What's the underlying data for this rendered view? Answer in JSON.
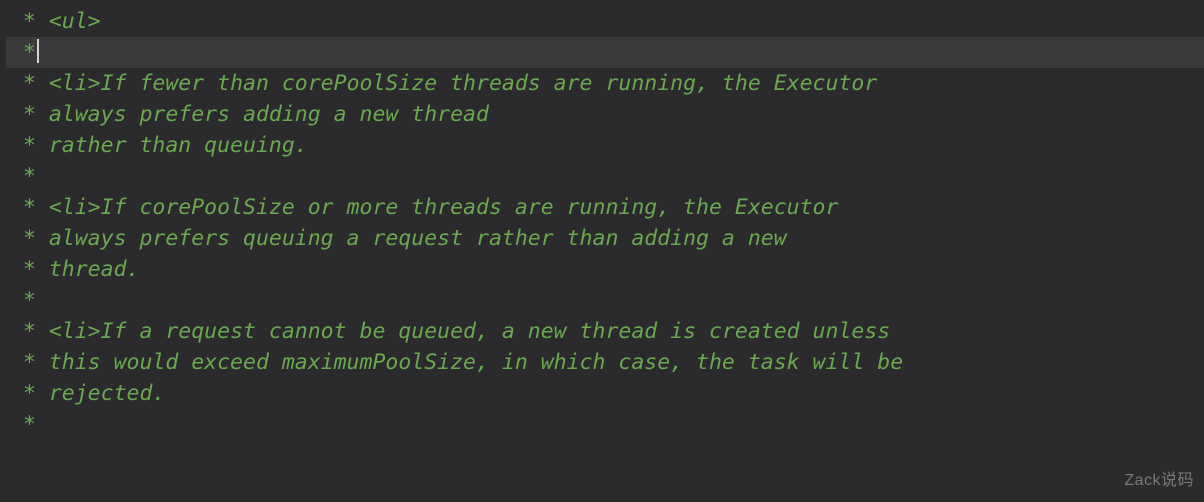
{
  "watermark": "Zack说码",
  "lines": [
    {
      "prefix": " * ",
      "tag": "<ul>",
      "text": "",
      "current": false
    },
    {
      "prefix": " *",
      "tag": "",
      "text": "",
      "current": true
    },
    {
      "prefix": " * ",
      "tag": "<li>",
      "text": "If fewer than corePoolSize threads are running, the Executor",
      "current": false
    },
    {
      "prefix": " * ",
      "tag": "",
      "text": "always prefers adding a new thread",
      "current": false
    },
    {
      "prefix": " * ",
      "tag": "",
      "text": "rather than queuing.",
      "current": false
    },
    {
      "prefix": " *",
      "tag": "",
      "text": "",
      "current": false
    },
    {
      "prefix": " * ",
      "tag": "<li>",
      "text": "If corePoolSize or more threads are running, the Executor",
      "current": false
    },
    {
      "prefix": " * ",
      "tag": "",
      "text": "always prefers queuing a request rather than adding a new",
      "current": false
    },
    {
      "prefix": " * ",
      "tag": "",
      "text": "thread.",
      "current": false
    },
    {
      "prefix": " *",
      "tag": "",
      "text": "",
      "current": false
    },
    {
      "prefix": " * ",
      "tag": "<li>",
      "text": "If a request cannot be queued, a new thread is created unless",
      "current": false
    },
    {
      "prefix": " * ",
      "tag": "",
      "text": "this would exceed maximumPoolSize, in which case, the task will be",
      "current": false
    },
    {
      "prefix": " * ",
      "tag": "",
      "text": "rejected.",
      "current": false
    },
    {
      "prefix": " *",
      "tag": "",
      "text": "",
      "current": false
    }
  ]
}
